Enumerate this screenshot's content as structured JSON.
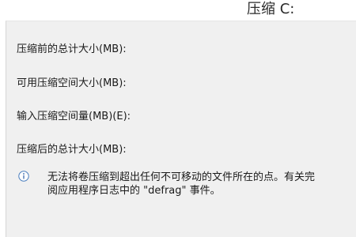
{
  "window": {
    "title": "压缩 C:"
  },
  "fields": [
    {
      "label": "压缩前的总计大小(MB):"
    },
    {
      "label": "可用压缩空间大小(MB):"
    },
    {
      "label": "输入压缩空间量(MB)(E):"
    },
    {
      "label": "压缩后的总计大小(MB):"
    }
  ],
  "info": {
    "icon": "info-icon",
    "line1": "无法将卷压缩到超出任何不可移动的文件所在的点。有关完",
    "line2": "阅应用程序日志中的 \"defrag\" 事件。"
  }
}
